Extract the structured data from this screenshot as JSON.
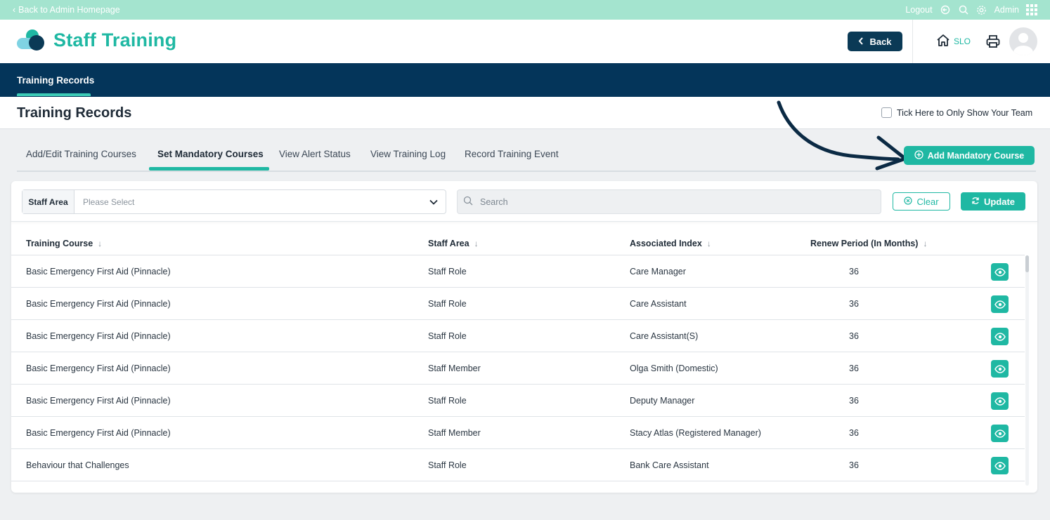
{
  "topbar": {
    "back_link": "Back to Admin Homepage",
    "logout": "Logout",
    "admin": "Admin"
  },
  "header": {
    "app_title": "Staff Training",
    "back_button": "Back",
    "home_label": "SLO"
  },
  "nav": {
    "tabs": [
      {
        "label": "Training Records"
      }
    ]
  },
  "page": {
    "title": "Training Records",
    "team_checkbox_label": "Tick Here to Only Show Your Team"
  },
  "tabs": [
    {
      "label": "Add/Edit Training Courses"
    },
    {
      "label": "Set Mandatory Courses"
    },
    {
      "label": "View Alert Status"
    },
    {
      "label": "View Training Log"
    },
    {
      "label": "Record Training Event"
    }
  ],
  "add_button": "Add Mandatory Course",
  "filters": {
    "staff_area_label": "Staff Area",
    "staff_area_value": "Please Select",
    "search_placeholder": "Search",
    "clear_label": "Clear",
    "update_label": "Update"
  },
  "table": {
    "columns": [
      "Training Course",
      "Staff Area",
      "Associated Index",
      "Renew Period (In Months)"
    ],
    "rows": [
      {
        "course": "Basic Emergency First Aid (Pinnacle)",
        "area": "Staff Role",
        "index": "Care Manager",
        "renew": "36"
      },
      {
        "course": "Basic Emergency First Aid (Pinnacle)",
        "area": "Staff Role",
        "index": "Care Assistant",
        "renew": "36"
      },
      {
        "course": "Basic Emergency First Aid (Pinnacle)",
        "area": "Staff Role",
        "index": "Care Assistant(S)",
        "renew": "36"
      },
      {
        "course": "Basic Emergency First Aid (Pinnacle)",
        "area": "Staff Member",
        "index": "Olga Smith (Domestic)",
        "renew": "36"
      },
      {
        "course": "Basic Emergency First Aid (Pinnacle)",
        "area": "Staff Role",
        "index": "Deputy Manager",
        "renew": "36"
      },
      {
        "course": "Basic Emergency First Aid (Pinnacle)",
        "area": "Staff Member",
        "index": "Stacy Atlas (Registered Manager)",
        "renew": "36"
      },
      {
        "course": "Behaviour that Challenges",
        "area": "Staff Role",
        "index": "Bank Care Assistant",
        "renew": "36"
      }
    ]
  },
  "colors": {
    "accent": "#1fb8a3",
    "navy": "#04355a",
    "topbar": "#a4e4cf"
  }
}
